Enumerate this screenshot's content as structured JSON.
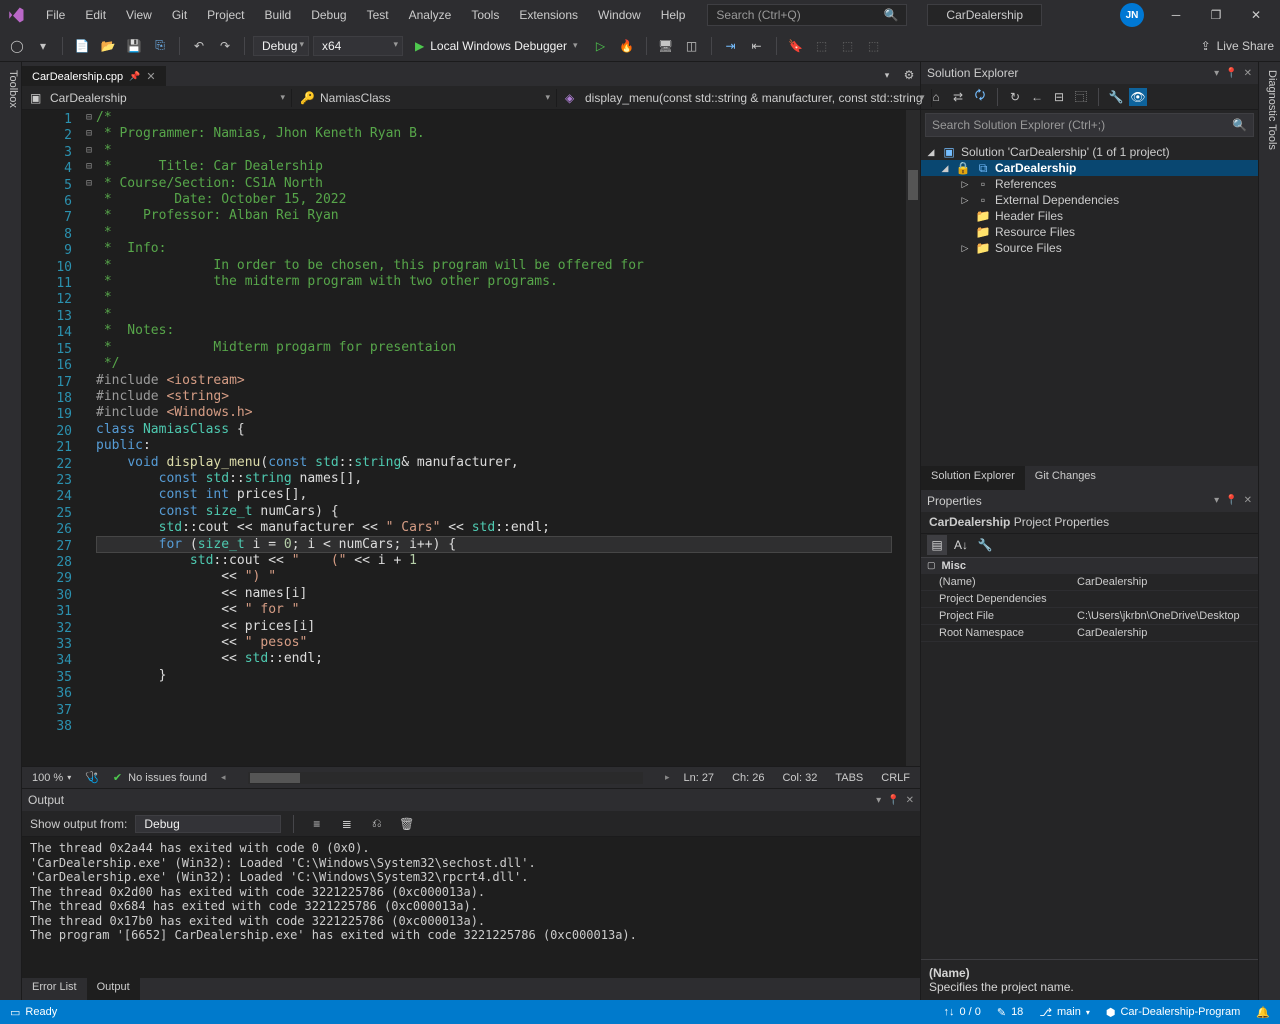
{
  "menus": [
    "File",
    "Edit",
    "View",
    "Git",
    "Project",
    "Build",
    "Debug",
    "Test",
    "Analyze",
    "Tools",
    "Extensions",
    "Window",
    "Help"
  ],
  "search_placeholder": "Search (Ctrl+Q)",
  "solution_label": "CarDealership",
  "user_initials": "JN",
  "toolbar": {
    "config": "Debug",
    "platform": "x64",
    "debugger": "Local Windows Debugger",
    "live_share": "Live Share"
  },
  "left_strip": "Toolbox",
  "right_strip": "Diagnostic Tools",
  "file_tab": "CarDealership.cpp",
  "nav": {
    "project": "CarDealership",
    "class": "NamiasClass",
    "func": "display_menu(const std::string & manufacturer, const std::string"
  },
  "code_lines": [
    {
      "n": 1,
      "fold": "⊟",
      "spans": [
        [
          "c-comment",
          "/*"
        ]
      ]
    },
    {
      "n": 2,
      "spans": [
        [
          "c-comment",
          " * Programmer: Namias, Jhon Keneth Ryan B."
        ]
      ]
    },
    {
      "n": 3,
      "spans": [
        [
          "c-comment",
          " *"
        ]
      ]
    },
    {
      "n": 4,
      "spans": [
        [
          "c-comment",
          " *      Title: Car Dealership"
        ]
      ]
    },
    {
      "n": 5,
      "spans": [
        [
          "c-comment",
          " * Course/Section: CS1A North"
        ]
      ]
    },
    {
      "n": 6,
      "spans": [
        [
          "c-comment",
          " *        Date: October 15, 2022"
        ]
      ]
    },
    {
      "n": 7,
      "spans": [
        [
          "c-comment",
          " *    Professor: Alban Rei Ryan"
        ]
      ]
    },
    {
      "n": 8,
      "spans": [
        [
          "c-comment",
          " *"
        ]
      ]
    },
    {
      "n": 9,
      "spans": [
        [
          "c-comment",
          " *  Info:"
        ]
      ]
    },
    {
      "n": 10,
      "spans": [
        [
          "c-comment",
          " *             In order to be chosen, this program will be offered for"
        ]
      ]
    },
    {
      "n": 11,
      "spans": [
        [
          "c-comment",
          " *             the midterm program with two other programs."
        ]
      ]
    },
    {
      "n": 12,
      "spans": [
        [
          "c-comment",
          " *"
        ]
      ]
    },
    {
      "n": 13,
      "spans": [
        [
          "c-comment",
          " *"
        ]
      ]
    },
    {
      "n": 14,
      "spans": [
        [
          "c-comment",
          " *  Notes:"
        ]
      ]
    },
    {
      "n": 15,
      "spans": [
        [
          "c-comment",
          " *             Midterm progarm for presentaion"
        ]
      ]
    },
    {
      "n": 16,
      "spans": [
        [
          "c-comment",
          " */"
        ]
      ]
    },
    {
      "n": 17,
      "spans": [
        [
          "",
          ""
        ]
      ]
    },
    {
      "n": 18,
      "fold": "⊟",
      "spans": [
        [
          "c-pre",
          "#include "
        ],
        [
          "c-string",
          "<iostream>"
        ]
      ]
    },
    {
      "n": 19,
      "spans": [
        [
          "c-pre",
          "#include "
        ],
        [
          "c-string",
          "<string>"
        ]
      ]
    },
    {
      "n": 20,
      "spans": [
        [
          "c-pre",
          "#include "
        ],
        [
          "c-string",
          "<Windows.h>"
        ]
      ]
    },
    {
      "n": 21,
      "spans": [
        [
          "",
          ""
        ]
      ]
    },
    {
      "n": 22,
      "fold": "⊟",
      "spans": [
        [
          "c-keyword",
          "class"
        ],
        [
          "",
          " "
        ],
        [
          "c-type",
          "NamiasClass"
        ],
        [
          "",
          " {"
        ]
      ]
    },
    {
      "n": 23,
      "spans": [
        [
          "c-keyword",
          "public"
        ],
        [
          "",
          ":"
        ]
      ]
    },
    {
      "n": 24,
      "fold": "⊟",
      "spans": [
        [
          "",
          "    "
        ],
        [
          "c-keyword",
          "void"
        ],
        [
          "",
          " "
        ],
        [
          "c-func",
          "display_menu"
        ],
        [
          "",
          "("
        ],
        [
          "c-keyword",
          "const"
        ],
        [
          "",
          " "
        ],
        [
          "c-type",
          "std"
        ],
        [
          "",
          "::"
        ],
        [
          "c-type",
          "string"
        ],
        [
          "",
          "& manufacturer,"
        ]
      ]
    },
    {
      "n": 25,
      "spans": [
        [
          "",
          "        "
        ],
        [
          "c-keyword",
          "const"
        ],
        [
          "",
          " "
        ],
        [
          "c-type",
          "std"
        ],
        [
          "",
          "::"
        ],
        [
          "c-type",
          "string"
        ],
        [
          "",
          " names[],"
        ]
      ]
    },
    {
      "n": 26,
      "spans": [
        [
          "",
          "        "
        ],
        [
          "c-keyword",
          "const"
        ],
        [
          "",
          " "
        ],
        [
          "c-keyword",
          "int"
        ],
        [
          "",
          " prices[],"
        ]
      ]
    },
    {
      "n": 27,
      "hl": true,
      "spans": [
        [
          "",
          "        "
        ],
        [
          "c-keyword",
          "const"
        ],
        [
          "",
          " "
        ],
        [
          "c-type",
          "size_t"
        ],
        [
          "",
          " numCars) {"
        ]
      ]
    },
    {
      "n": 28,
      "spans": [
        [
          "",
          "        "
        ],
        [
          "c-type",
          "std"
        ],
        [
          "",
          "::cout << manufacturer << "
        ],
        [
          "c-string",
          "\" Cars\""
        ],
        [
          "",
          " << "
        ],
        [
          "c-type",
          "std"
        ],
        [
          "",
          "::endl;"
        ]
      ]
    },
    {
      "n": 29,
      "spans": [
        [
          "",
          ""
        ]
      ]
    },
    {
      "n": 30,
      "fold": "⊟",
      "spans": [
        [
          "",
          "        "
        ],
        [
          "c-keyword",
          "for"
        ],
        [
          "",
          " ("
        ],
        [
          "c-type",
          "size_t"
        ],
        [
          "",
          " i = "
        ],
        [
          "c-num",
          "0"
        ],
        [
          "",
          "; i < numCars; i++) {"
        ]
      ]
    },
    {
      "n": 31,
      "spans": [
        [
          "",
          "            "
        ],
        [
          "c-type",
          "std"
        ],
        [
          "",
          "::cout << "
        ],
        [
          "c-string",
          "\"    (\""
        ],
        [
          "",
          " << i + "
        ],
        [
          "c-num",
          "1"
        ]
      ]
    },
    {
      "n": 32,
      "spans": [
        [
          "",
          "                << "
        ],
        [
          "c-string",
          "\") \""
        ]
      ]
    },
    {
      "n": 33,
      "spans": [
        [
          "",
          "                << names[i]"
        ]
      ]
    },
    {
      "n": 34,
      "spans": [
        [
          "",
          "                << "
        ],
        [
          "c-string",
          "\" for \""
        ]
      ]
    },
    {
      "n": 35,
      "spans": [
        [
          "",
          "                << prices[i]"
        ]
      ]
    },
    {
      "n": 36,
      "spans": [
        [
          "",
          "                << "
        ],
        [
          "c-string",
          "\" pesos\""
        ]
      ]
    },
    {
      "n": 37,
      "spans": [
        [
          "",
          "                << "
        ],
        [
          "c-type",
          "std"
        ],
        [
          "",
          "::endl;"
        ]
      ]
    },
    {
      "n": 38,
      "spans": [
        [
          "",
          "        }"
        ]
      ]
    }
  ],
  "editor_status": {
    "zoom": "100 %",
    "issues": "No issues found",
    "ln": "Ln: 27",
    "ch": "Ch: 26",
    "col": "Col: 32",
    "tabs": "TABS",
    "crlf": "CRLF"
  },
  "output": {
    "title": "Output",
    "from_label": "Show output from:",
    "from_value": "Debug",
    "lines": [
      "The thread 0x2a44 has exited with code 0 (0x0).",
      "'CarDealership.exe' (Win32): Loaded 'C:\\Windows\\System32\\sechost.dll'.",
      "'CarDealership.exe' (Win32): Loaded 'C:\\Windows\\System32\\rpcrt4.dll'.",
      "The thread 0x2d00 has exited with code 3221225786 (0xc000013a).",
      "The thread 0x684 has exited with code 3221225786 (0xc000013a).",
      "The thread 0x17b0 has exited with code 3221225786 (0xc000013a).",
      "The program '[6652] CarDealership.exe' has exited with code 3221225786 (0xc000013a)."
    ]
  },
  "bottom_tabs": [
    "Error List",
    "Output"
  ],
  "solution_explorer": {
    "title": "Solution Explorer",
    "search_placeholder": "Search Solution Explorer (Ctrl+;)",
    "solution": "Solution 'CarDealership' (1 of 1 project)",
    "project": "CarDealership",
    "nodes": [
      "References",
      "External Dependencies",
      "Header Files",
      "Resource Files",
      "Source Files"
    ],
    "tabs": [
      "Solution Explorer",
      "Git Changes"
    ]
  },
  "properties": {
    "title": "Properties",
    "subject": "CarDealership",
    "subject_type": "Project Properties",
    "category": "Misc",
    "rows": [
      {
        "k": "(Name)",
        "v": "CarDealership"
      },
      {
        "k": "Project Dependencies",
        "v": ""
      },
      {
        "k": "Project File",
        "v": "C:\\Users\\jkrbn\\OneDrive\\Desktop"
      },
      {
        "k": "Root Namespace",
        "v": "CarDealership"
      }
    ],
    "desc_title": "(Name)",
    "desc_text": "Specifies the project name."
  },
  "statusbar": {
    "ready": "Ready",
    "errors": "0 / 0",
    "changes": "18",
    "branch": "main",
    "repo": "Car-Dealership-Program"
  }
}
